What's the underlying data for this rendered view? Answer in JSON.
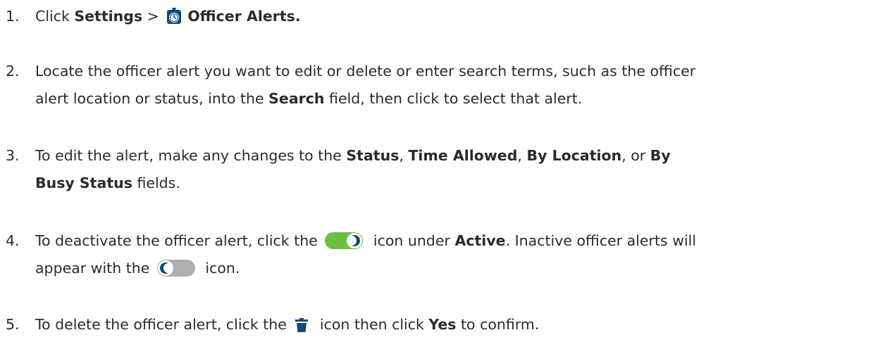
{
  "colors": {
    "text": "#2b2b2b",
    "toggle_on": "#6fbe44",
    "toggle_off": "#aeaeae",
    "icon_dark": "#0d4a7c"
  },
  "icons": {
    "stopwatch": "stopwatch-icon",
    "toggle_active": "toggle-active-icon",
    "toggle_inactive": "toggle-inactive-icon",
    "trash": "trash-icon"
  },
  "steps": [
    {
      "number": "1.",
      "t1": "Click ",
      "b1": "Settings",
      "t2": " > ",
      "b2": "Officer Alerts."
    },
    {
      "number": "2.",
      "t1": "Locate the officer alert you want to edit or delete or enter search terms, such as the officer",
      "t2": "alert location or status, into the ",
      "b1": "Search",
      "t3": " field, then click to select that alert."
    },
    {
      "number": "3.",
      "t1": "To edit the alert, make any changes to the ",
      "b1": "Status",
      "t2": ", ",
      "b2": "Time Allowed",
      "t3": ", ",
      "b3": "By Location",
      "t4": ", or ",
      "b4": "By",
      "b5": "Busy Status",
      "t5": " fields."
    },
    {
      "number": "4.",
      "t1": "To deactivate the officer alert, click the ",
      "t2": " icon under ",
      "b1": "Active",
      "t3": ". Inactive officer alerts will",
      "t4": "appear with the ",
      "t5": " icon."
    },
    {
      "number": "5.",
      "t1": "To delete the officer alert, click the ",
      "t2": " icon then click ",
      "b1": "Yes",
      "t3": " to confirm."
    }
  ]
}
